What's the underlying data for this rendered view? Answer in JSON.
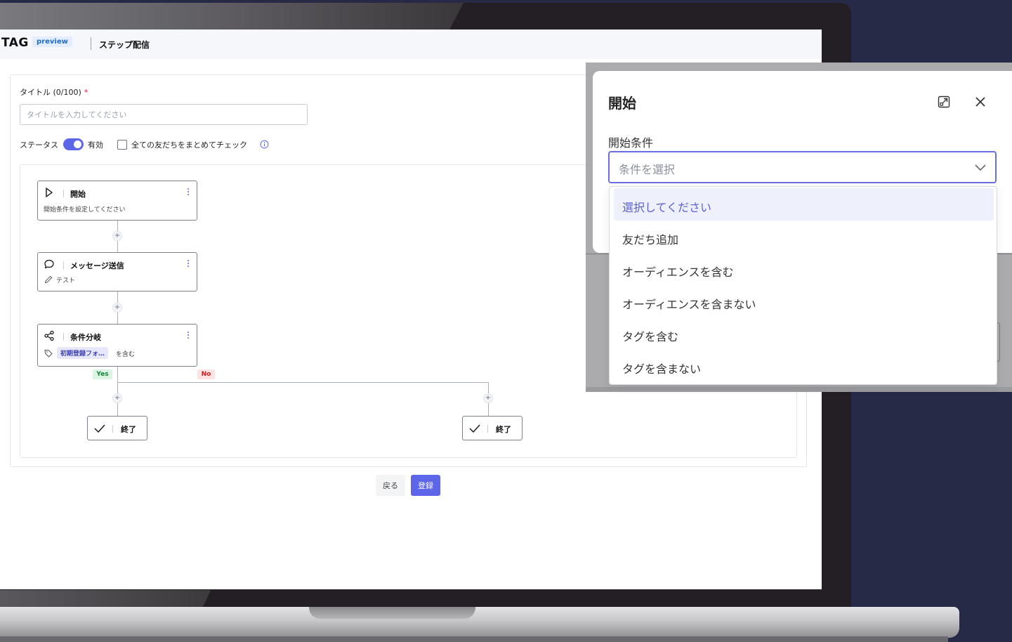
{
  "app": {
    "logo": "TAG",
    "badge": "preview",
    "page_name": "ステップ配信"
  },
  "form": {
    "title_label": "タイトル (0/100)",
    "required_mark": "*",
    "title_placeholder": "タイトルを入力してください",
    "title_value": "",
    "status_label": "ステータス",
    "status_toggle_label": "有効",
    "status_enabled": true,
    "bulk_check_label": "全ての友だちをまとめてチェック",
    "bulk_checked": false
  },
  "flow": {
    "start_node": {
      "title": "開始",
      "subtitle": "開始条件を設定してください"
    },
    "message_node": {
      "title": "メッセージ送信",
      "subtitle": "テスト"
    },
    "branch_node": {
      "title": "条件分岐",
      "tag": "初期登録フォ…",
      "tag_suffix": "を含む"
    },
    "yes_label": "Yes",
    "no_label": "No",
    "end_label": "終了",
    "plus": "+"
  },
  "actions": {
    "back": "戻る",
    "submit": "登録"
  },
  "modal": {
    "title": "開始",
    "condition_label": "開始条件",
    "select_placeholder": "条件を選択",
    "options": [
      {
        "label": "選択してください",
        "selected": true
      },
      {
        "label": "友だち追加",
        "selected": false
      },
      {
        "label": "オーディエンスを含む",
        "selected": false
      },
      {
        "label": "オーディエンスを含まない",
        "selected": false
      },
      {
        "label": "タグを含む",
        "selected": false
      },
      {
        "label": "タグを含まない",
        "selected": false
      }
    ]
  },
  "colors": {
    "accent": "#5d66e8",
    "yes": "#15803d",
    "no": "#c81e1e",
    "background": "#262a47"
  }
}
